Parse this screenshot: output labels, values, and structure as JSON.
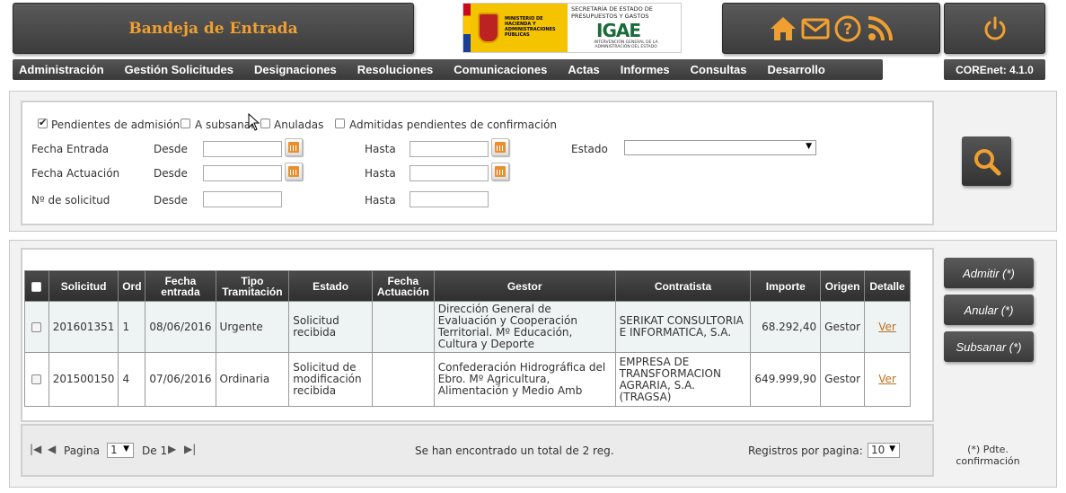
{
  "header": {
    "title": "Bandeja de Entrada",
    "logo": {
      "ministry": "MINISTERIO DE HACIENDA Y ADMINISTRACIONES PÚBLICAS",
      "secretaria": "SECRETARÍA DE ESTADO DE PRESUPUESTOS Y GASTOS",
      "brand": "IGAE",
      "brand_sub": "INTERVENCIÓN GENERAL DE LA ADMINISTRACIÓN DEL ESTADO"
    },
    "icon_color": "#f0a030",
    "icons": [
      "home-icon",
      "mail-icon",
      "help-icon",
      "rss-icon"
    ],
    "power_icon": "power-icon"
  },
  "menu": {
    "items": [
      "Administración",
      "Gestión Solicitudes",
      "Designaciones",
      "Resoluciones",
      "Comunicaciones",
      "Actas",
      "Informes",
      "Consultas",
      "Desarrollo"
    ],
    "version": "COREnet: 4.1.0"
  },
  "filters": {
    "checkboxes": [
      {
        "label": "Pendientes de admisión",
        "checked": true
      },
      {
        "label": "A subsanar",
        "checked": false
      },
      {
        "label": "Anuladas",
        "checked": false
      },
      {
        "label": "Admitidas pendientes de confirmación",
        "checked": false
      }
    ],
    "fecha_entrada": "Fecha Entrada",
    "fecha_actuacion": "Fecha Actuación",
    "num_solicitud": "Nº de solicitud",
    "desde": "Desde",
    "hasta": "Hasta",
    "estado": "Estado",
    "estado_value": ""
  },
  "table": {
    "headers": [
      "",
      "Solicitud",
      "Ord",
      "Fecha entrada",
      "Tipo Tramitación",
      "Estado",
      "Fecha Actuación",
      "Gestor",
      "Contratista",
      "Importe",
      "Origen",
      "Detalle"
    ],
    "rows": [
      {
        "solicitud": "201601351",
        "ord": "1",
        "fecha": "08/06/2016",
        "tipo": "Urgente",
        "estado": "Solicitud recibida",
        "fecha_act": "",
        "gestor": "Dirección General de Evaluación y Cooperación Territorial. Mº Educación, Cultura y Deporte",
        "contratista": "SERIKAT CONSULTORIA E INFORMATICA, S.A.",
        "importe": "68.292,40",
        "origen": "Gestor",
        "detalle": "Ver"
      },
      {
        "solicitud": "201500150",
        "ord": "4",
        "fecha": "07/06/2016",
        "tipo": "Ordinaria",
        "estado": "Solicitud de modificación recibida",
        "fecha_act": "",
        "gestor": "Confederación Hidrográfica del Ebro. Mº Agricultura, Alimentación y Medio Amb",
        "contratista": "EMPRESA DE TRANSFORMACION AGRARIA, S.A. (TRAGSA)",
        "importe": "649.999,90",
        "origen": "Gestor",
        "detalle": "Ver"
      }
    ]
  },
  "pager": {
    "pagina_label": "Pagina",
    "page": "1",
    "de_label": "De 1",
    "total_text": "Se han encontrado un total de 2 reg.",
    "per_page_label": "Registros por pagina:",
    "per_page": "10"
  },
  "actions": {
    "admitir": "Admitir (*)",
    "anular": "Anular (*)",
    "subsanar": "Subsanar (*)",
    "note": "(*) Pdte. confirmación"
  }
}
